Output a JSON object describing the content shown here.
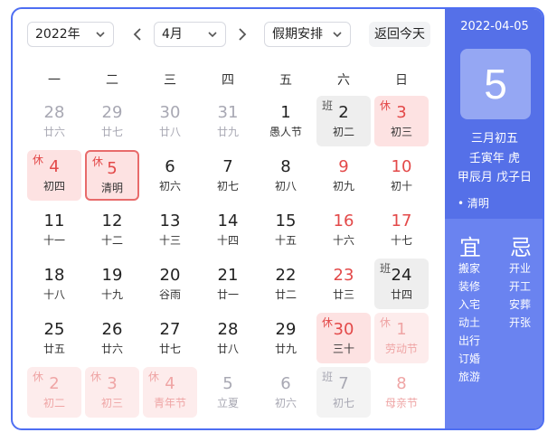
{
  "toolbar": {
    "year": "2022年",
    "month": "4月",
    "holiday_select": "假期安排",
    "today_button": "返回今天"
  },
  "weekdays": [
    "一",
    "二",
    "三",
    "四",
    "五",
    "六",
    "日"
  ],
  "cells": [
    {
      "day": "28",
      "lunar": "廿六",
      "tag": "",
      "kind": "other"
    },
    {
      "day": "29",
      "lunar": "廿七",
      "tag": "",
      "kind": "other"
    },
    {
      "day": "30",
      "lunar": "廿八",
      "tag": "",
      "kind": "other"
    },
    {
      "day": "31",
      "lunar": "廿九",
      "tag": "",
      "kind": "other"
    },
    {
      "day": "1",
      "lunar": "愚人节",
      "tag": "",
      "kind": "normal"
    },
    {
      "day": "2",
      "lunar": "初二",
      "tag": "班",
      "kind": "work"
    },
    {
      "day": "3",
      "lunar": "初三",
      "tag": "休",
      "kind": "rest"
    },
    {
      "day": "4",
      "lunar": "初四",
      "tag": "休",
      "kind": "rest"
    },
    {
      "day": "5",
      "lunar": "清明",
      "tag": "休",
      "kind": "rest selected"
    },
    {
      "day": "6",
      "lunar": "初六",
      "tag": "",
      "kind": "normal"
    },
    {
      "day": "7",
      "lunar": "初七",
      "tag": "",
      "kind": "normal"
    },
    {
      "day": "8",
      "lunar": "初八",
      "tag": "",
      "kind": "normal"
    },
    {
      "day": "9",
      "lunar": "初九",
      "tag": "",
      "kind": "weekend"
    },
    {
      "day": "10",
      "lunar": "初十",
      "tag": "",
      "kind": "weekend"
    },
    {
      "day": "11",
      "lunar": "十一",
      "tag": "",
      "kind": "normal"
    },
    {
      "day": "12",
      "lunar": "十二",
      "tag": "",
      "kind": "normal"
    },
    {
      "day": "13",
      "lunar": "十三",
      "tag": "",
      "kind": "normal"
    },
    {
      "day": "14",
      "lunar": "十四",
      "tag": "",
      "kind": "normal"
    },
    {
      "day": "15",
      "lunar": "十五",
      "tag": "",
      "kind": "normal"
    },
    {
      "day": "16",
      "lunar": "十六",
      "tag": "",
      "kind": "weekend"
    },
    {
      "day": "17",
      "lunar": "十七",
      "tag": "",
      "kind": "weekend"
    },
    {
      "day": "18",
      "lunar": "十八",
      "tag": "",
      "kind": "normal"
    },
    {
      "day": "19",
      "lunar": "十九",
      "tag": "",
      "kind": "normal"
    },
    {
      "day": "20",
      "lunar": "谷雨",
      "tag": "",
      "kind": "normal"
    },
    {
      "day": "21",
      "lunar": "廿一",
      "tag": "",
      "kind": "normal"
    },
    {
      "day": "22",
      "lunar": "廿二",
      "tag": "",
      "kind": "normal"
    },
    {
      "day": "23",
      "lunar": "廿三",
      "tag": "",
      "kind": "weekend"
    },
    {
      "day": "24",
      "lunar": "廿四",
      "tag": "班",
      "kind": "work"
    },
    {
      "day": "25",
      "lunar": "廿五",
      "tag": "",
      "kind": "normal"
    },
    {
      "day": "26",
      "lunar": "廿六",
      "tag": "",
      "kind": "normal"
    },
    {
      "day": "27",
      "lunar": "廿七",
      "tag": "",
      "kind": "normal"
    },
    {
      "day": "28",
      "lunar": "廿八",
      "tag": "",
      "kind": "normal"
    },
    {
      "day": "29",
      "lunar": "廿九",
      "tag": "",
      "kind": "normal"
    },
    {
      "day": "30",
      "lunar": "三十",
      "tag": "休",
      "kind": "rest"
    },
    {
      "day": "1",
      "lunar": "劳动节",
      "tag": "休",
      "kind": "other rest"
    },
    {
      "day": "2",
      "lunar": "初二",
      "tag": "休",
      "kind": "other rest"
    },
    {
      "day": "3",
      "lunar": "初三",
      "tag": "休",
      "kind": "other rest"
    },
    {
      "day": "4",
      "lunar": "青年节",
      "tag": "休",
      "kind": "other rest"
    },
    {
      "day": "5",
      "lunar": "立夏",
      "tag": "",
      "kind": "other"
    },
    {
      "day": "6",
      "lunar": "初六",
      "tag": "",
      "kind": "other"
    },
    {
      "day": "7",
      "lunar": "初七",
      "tag": "班",
      "kind": "other work"
    },
    {
      "day": "8",
      "lunar": "母亲节",
      "tag": "",
      "kind": "other weekend"
    }
  ],
  "panel": {
    "date": "2022-04-05",
    "day": "5",
    "lunar_date": "三月初五",
    "year_ganzhi": "壬寅年 虎",
    "month_day_ganzhi": "甲辰月 戊子日",
    "festival": "• 清明",
    "yi_title": "宜",
    "ji_title": "忌",
    "yi": [
      "搬家",
      "装修",
      "入宅",
      "动土",
      "出行",
      "订婚",
      "旅游"
    ],
    "ji": [
      "开业",
      "开工",
      "安葬",
      "开张"
    ]
  },
  "colors": {
    "accent": "#4e6ef2",
    "holiday_red": "#e34949",
    "rest_bg": "#fde2e2",
    "work_bg": "#eeeeee"
  }
}
